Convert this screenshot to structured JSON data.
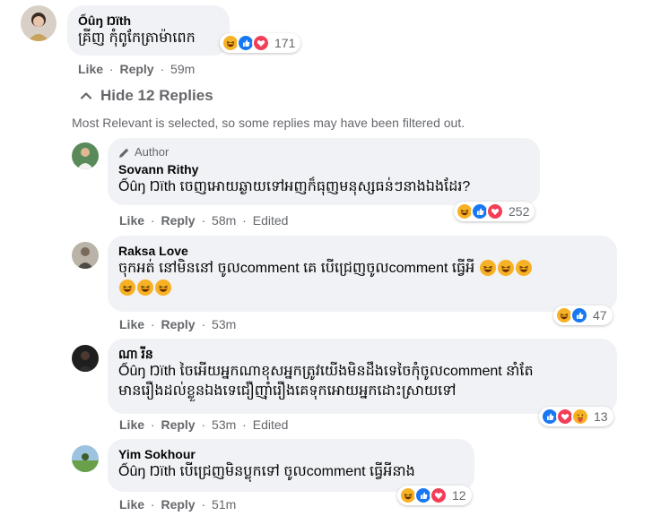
{
  "colors": {
    "bubble": "#f0f2f5",
    "secondary_text": "#65676b",
    "like_blue": "#1877f2",
    "love_red": "#f33e58",
    "haha_yellow": "#f7b125"
  },
  "top_comment": {
    "author": "Ốûŋ Ŋïth",
    "text": "គ្រីញ កុំពូកែត្រាម៉ាពេក",
    "like_label": "Like",
    "reply_label": "Reply",
    "time": "59m",
    "reaction_count": "171",
    "reaction_icons": [
      "haha-icon",
      "like-icon",
      "love-icon"
    ]
  },
  "replies_toggle": {
    "label": "Hide 12 Replies",
    "filter_note": "Most Relevant is selected, so some replies may have been filtered out."
  },
  "replies": [
    {
      "badge": "Author",
      "author": "Sovann Rithy",
      "mention": "Ốûŋ Ŋïth",
      "text": "ចេញអោយឆ្ងាយទៅអញក៏ធុញមនុស្សធន់ៗនាងឯងដែរ?",
      "like_label": "Like",
      "reply_label": "Reply",
      "time": "58m",
      "edited": "Edited",
      "reaction_count": "252",
      "reaction_icons": [
        "haha-icon",
        "like-icon",
        "love-icon"
      ]
    },
    {
      "author": "Raksa Love",
      "text_line1": "ចុកអត់ នៅមិននៅ ចូលcomment គេ បើជ្រេញចូលcomment ធ្វើអី",
      "like_label": "Like",
      "reply_label": "Reply",
      "time": "53m",
      "reaction_count": "47",
      "reaction_icons": [
        "haha-icon",
        "like-icon"
      ]
    },
    {
      "author": "ណា រីន",
      "mention": "Ốûŋ Ŋïth",
      "text_line1": "ចៃអើយអ្នកណាខុសអ្នកត្រូវយើងមិនដឹងទេចៃកុំចូលcomment នាំតែ",
      "text_line2": "មានរឿងដល់ខ្លួនឯងទេជឿញ៉ាំរឿងគេទុកអោយអ្នកដោះស្រាយទៅ",
      "like_label": "Like",
      "reply_label": "Reply",
      "time": "53m",
      "edited": "Edited",
      "reaction_count": "13",
      "reaction_icons": [
        "like-icon",
        "love-icon",
        "care-icon"
      ]
    },
    {
      "author": "Yim Sokhour",
      "mention": "Ốûŋ Ŋïth",
      "text": "បើជ្រេញមិនប្លុកទៅ ចូលcomment ធ្វើអីនាង",
      "like_label": "Like",
      "reply_label": "Reply",
      "time": "51m",
      "reaction_count": "12",
      "reaction_icons": [
        "haha-icon",
        "like-icon",
        "love-icon"
      ]
    }
  ]
}
